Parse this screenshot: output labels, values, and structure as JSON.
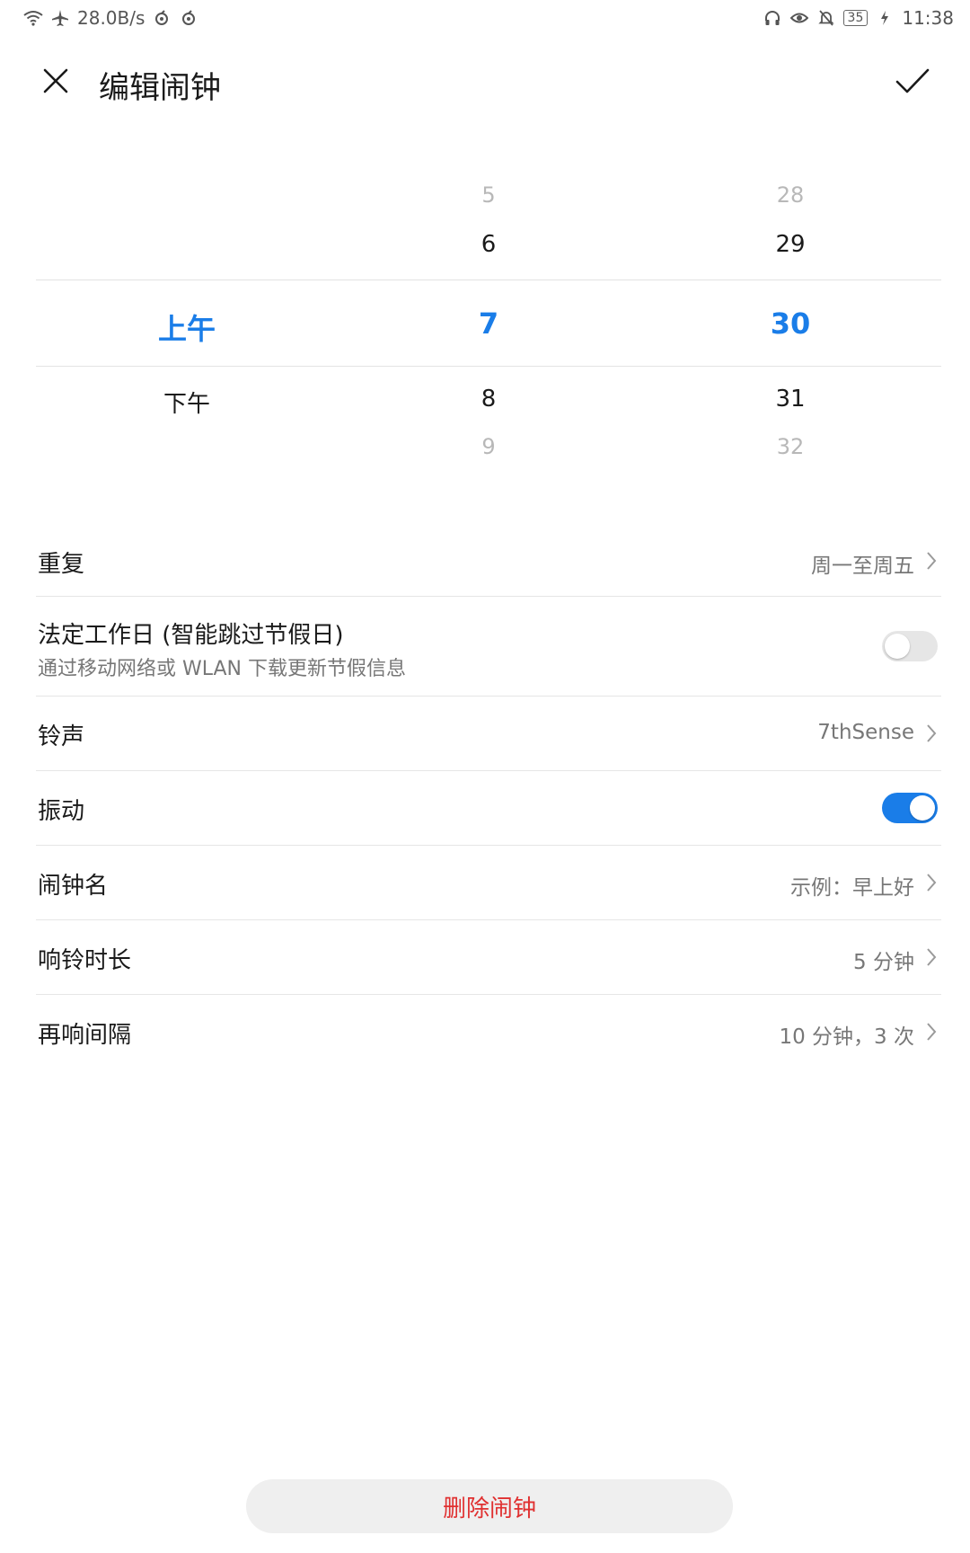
{
  "status_bar": {
    "net_speed": "28.0B/s",
    "battery": "35",
    "time": "11:38"
  },
  "header": {
    "title": "编辑闹钟"
  },
  "picker": {
    "ampm": {
      "selected": "上午",
      "next": "下午"
    },
    "hour": {
      "far_prev": "5",
      "prev": "6",
      "selected": "7",
      "next": "8",
      "far_next": "9"
    },
    "minute": {
      "far_prev": "28",
      "prev": "29",
      "selected": "30",
      "next": "31",
      "far_next": "32"
    },
    "accent_color": "#1a7de8"
  },
  "settings": {
    "repeat": {
      "label": "重复",
      "value": "周一至周五"
    },
    "workday": {
      "label": "法定工作日 (智能跳过节假日)",
      "sub": "通过移动网络或 WLAN 下载更新节假信息",
      "enabled": false
    },
    "ringtone": {
      "label": "铃声",
      "value": "7thSense"
    },
    "vibrate": {
      "label": "振动",
      "enabled": true
    },
    "alarm_name": {
      "label": "闹钟名",
      "value": "示例：早上好"
    },
    "ring_duration": {
      "label": "响铃时长",
      "value": "5 分钟"
    },
    "snooze": {
      "label": "再响间隔",
      "value": "10 分钟，3 次"
    }
  },
  "actions": {
    "delete_label": "删除闹钟",
    "delete_color": "#e03030"
  },
  "icons": {
    "close": "close-icon",
    "confirm": "check-icon",
    "chevron": "chevron-right-icon"
  }
}
